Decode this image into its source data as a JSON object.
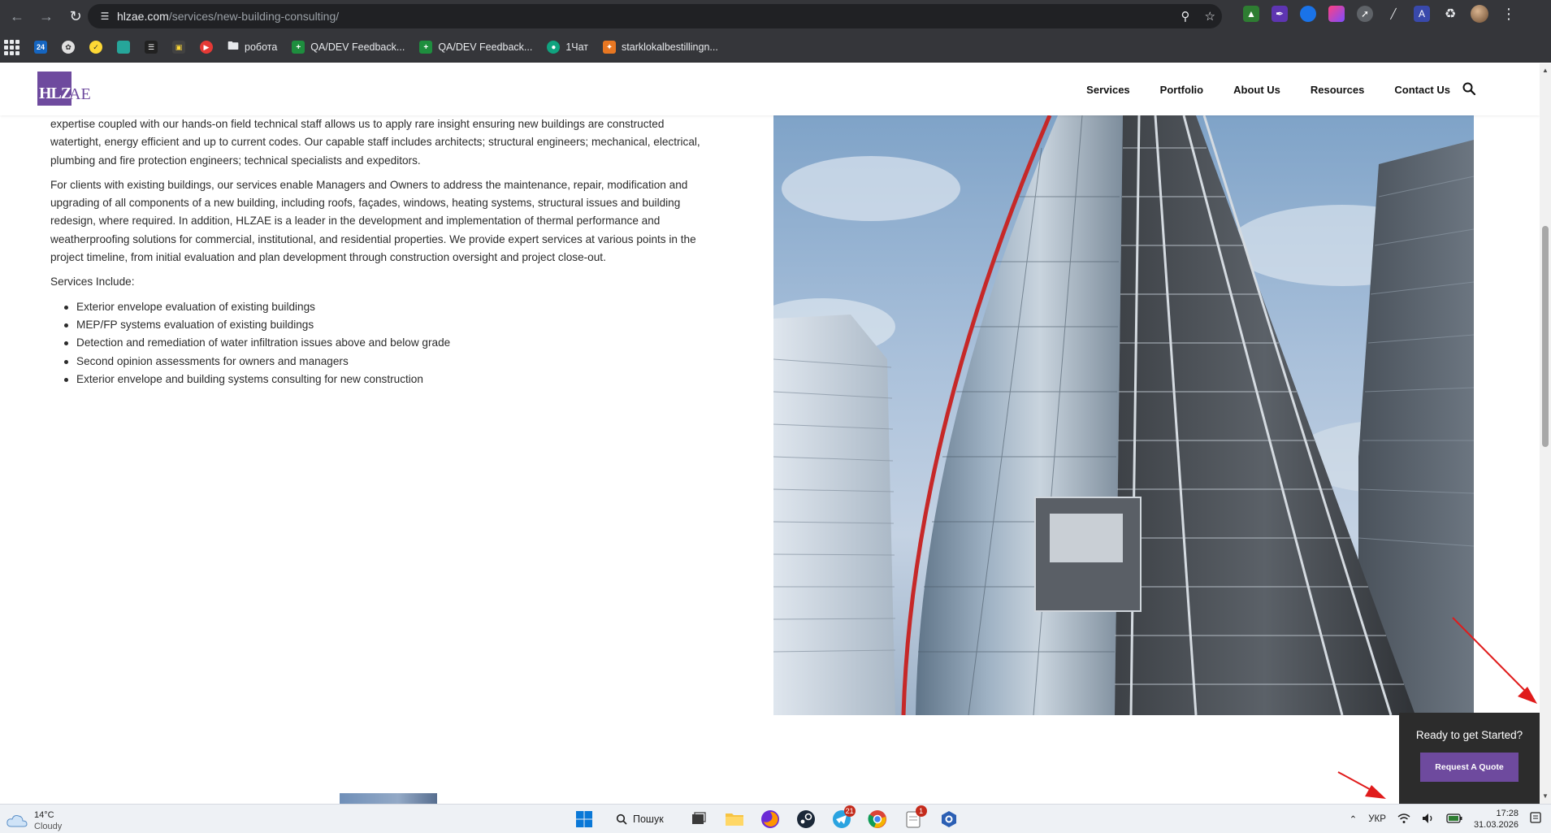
{
  "browser": {
    "url_host": "hlzae.com",
    "url_path": "/services/new-building-consulting/",
    "bookmarks": [
      {
        "label": "робота",
        "icon": "folder-icon"
      },
      {
        "label": "QA/DEV Feedback...",
        "icon": "sheets-icon",
        "color": "#1e8e3e"
      },
      {
        "label": "QA/DEV Feedback...",
        "icon": "sheets-icon",
        "color": "#1e8e3e"
      },
      {
        "label": "1Чат",
        "icon": "chat-icon",
        "color": "#10a37f"
      },
      {
        "label": "starklokalbestillingn...",
        "icon": "orange-app-icon",
        "color": "#e87722"
      }
    ]
  },
  "site": {
    "logo_text": "HLZ",
    "logo_tail": "AE",
    "brand_color": "#6e4a9e",
    "nav": [
      "Services",
      "Portfolio",
      "About Us",
      "Resources",
      "Contact Us"
    ]
  },
  "content": {
    "p1_lines": [
      "expertise coupled with our hands-on field technical staff allows us to apply rare insight ensuring new buildings are constructed",
      "watertight, energy efficient and up to current codes. Our capable staff includes architects; structural engineers; mechanical, electrical,",
      "plumbing and fire protection engineers; technical specialists and expeditors."
    ],
    "p2_lines": [
      "For clients with existing buildings, our services enable Managers and Owners to address the maintenance, repair, modification and",
      "upgrading of all components of a new building, including roofs, façades, windows, heating systems, structural issues and building",
      "redesign, where required. In addition, HLZAE is a leader in the development and implementation of thermal performance and",
      "weatherproofing solutions for commercial, institutional, and residential properties. We provide expert services at various points in the",
      "project timeline, from initial evaluation and plan development through construction oversight and project close-out."
    ],
    "services_heading": "Services Include:",
    "services": [
      "Exterior envelope evaluation of existing buildings",
      "MEP/FP systems evaluation of existing buildings",
      "Detection and remediation of water infiltration issues above and below grade",
      "Second opinion assessments for owners and managers",
      "Exterior envelope and building systems consulting for new construction"
    ]
  },
  "quote": {
    "title": "Ready to get Started?",
    "button": "Request A Quote"
  },
  "taskbar": {
    "weather_temp": "14°C",
    "weather_desc": "Cloudy",
    "search_label": "Пошук",
    "telegram_badge": "21",
    "notes_badge": "1",
    "lang": "УКР",
    "time": "17:28",
    "date": "31.03.2026"
  }
}
